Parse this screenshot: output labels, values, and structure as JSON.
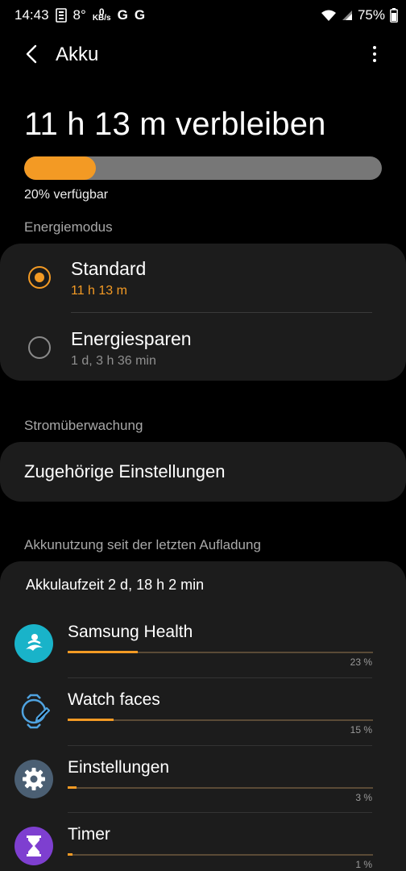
{
  "status_bar": {
    "time": "14:43",
    "temperature": "8°",
    "netspeed_value": "0",
    "netspeed_unit": "KB/s",
    "g1": "G",
    "g2": "G",
    "battery": "75%"
  },
  "app_bar": {
    "title": "Akku"
  },
  "battery": {
    "remaining": "11 h 13 m verbleiben",
    "level_fraction": 0.2,
    "available": "20% verfügbar",
    "fill_color": "#f39a24"
  },
  "energy_mode": {
    "label": "Energiemodus",
    "options": [
      {
        "title": "Standard",
        "subtitle": "11 h 13 m",
        "selected": true
      },
      {
        "title": "Energiesparen",
        "subtitle": "1 d, 3 h 36 min",
        "selected": false
      }
    ]
  },
  "monitoring": {
    "label": "Stromüberwachung",
    "related_settings": "Zugehörige Einstellungen"
  },
  "usage": {
    "label": "Akkunutzung seit der letzten Aufladung",
    "uptime": "Akkulaufzeit 2 d, 18 h 2 min",
    "apps": [
      {
        "name": "Samsung Health",
        "percent_label": "23 %",
        "percent": 23,
        "icon": "samsung-health-icon"
      },
      {
        "name": "Watch faces",
        "percent_label": "15 %",
        "percent": 15,
        "icon": "watch-faces-icon"
      },
      {
        "name": "Einstellungen",
        "percent_label": "3 %",
        "percent": 3,
        "icon": "settings-gear-icon"
      },
      {
        "name": "Timer",
        "percent_label": "1 %",
        "percent": 1,
        "icon": "hourglass-icon"
      }
    ]
  }
}
